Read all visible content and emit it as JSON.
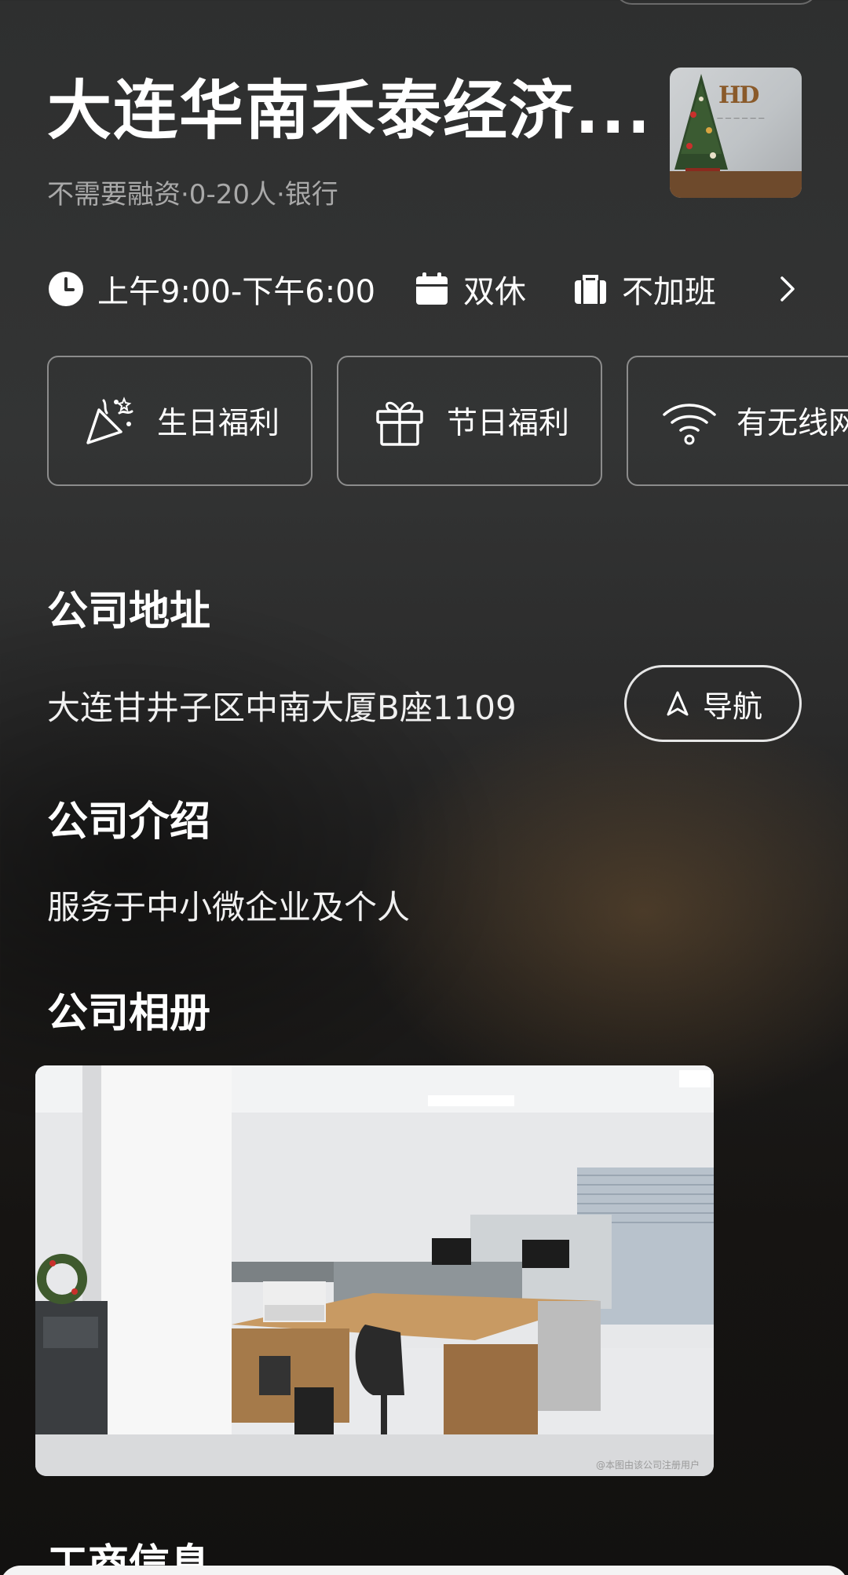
{
  "company": {
    "name": "大连华南禾泰经济...",
    "meta": "不需要融资·0-20人·银行"
  },
  "work_info": {
    "hours": "上午9:00-下午6:00",
    "rest": "双休",
    "overtime": "不加班"
  },
  "benefits": [
    {
      "label": "生日福利",
      "icon": "party-popper-icon"
    },
    {
      "label": "节日福利",
      "icon": "gift-icon"
    },
    {
      "label": "有无线网",
      "icon": "wifi-icon"
    }
  ],
  "address": {
    "title": "公司地址",
    "text": "大连甘井子区中南大厦B座1109",
    "nav_label": "导航"
  },
  "intro": {
    "title": "公司介绍",
    "text": "服务于中小微企业及个人"
  },
  "album": {
    "title": "公司相册",
    "watermark": "@本图由该公司注册用户"
  },
  "business_info": {
    "title": "工商信息"
  },
  "colors": {
    "background_top": "#333434",
    "background_bottom": "#121110",
    "secondary_text": "#a9a9a9",
    "border": "#8c8c8c"
  }
}
